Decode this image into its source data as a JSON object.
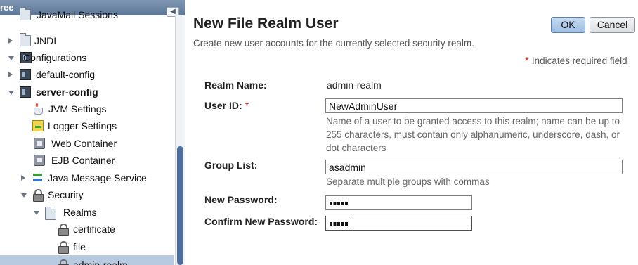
{
  "tree": {
    "header_title": "ree",
    "collapse_icon": "chevron-left-icon",
    "items": [
      {
        "label": "JavaMail Sessions",
        "icon": "folder-icon",
        "toggle": "none",
        "bold": false
      },
      {
        "label": "JNDI",
        "icon": "folder-icon",
        "toggle": "closed",
        "bold": false
      },
      {
        "label": "Configurations",
        "icon": "server-icon",
        "toggle": "open",
        "bold": false
      },
      {
        "label": "default-config",
        "icon": "server-icon",
        "toggle": "closed",
        "bold": false
      },
      {
        "label": "server-config",
        "icon": "server-icon",
        "toggle": "open",
        "bold": true
      },
      {
        "label": "JVM Settings",
        "icon": "jvm-icon",
        "toggle": "none",
        "bold": false
      },
      {
        "label": "Logger Settings",
        "icon": "logger-icon",
        "toggle": "none",
        "bold": false
      },
      {
        "label": "Web Container",
        "icon": "container-icon",
        "toggle": "none",
        "bold": false
      },
      {
        "label": "EJB Container",
        "icon": "container-icon",
        "toggle": "none",
        "bold": false
      },
      {
        "label": "Java Message Service",
        "icon": "jms-icon",
        "toggle": "closed",
        "bold": false
      },
      {
        "label": "Security",
        "icon": "lock-icon",
        "toggle": "open",
        "bold": false
      },
      {
        "label": "Realms",
        "icon": "folder-icon",
        "toggle": "open",
        "bold": false
      },
      {
        "label": "certificate",
        "icon": "lock-icon",
        "toggle": "none",
        "bold": false
      },
      {
        "label": "file",
        "icon": "lock-icon",
        "toggle": "none",
        "bold": false
      },
      {
        "label": "admin-realm",
        "icon": "lock-icon",
        "toggle": "none",
        "bold": false,
        "selected": true
      }
    ]
  },
  "page": {
    "title": "New File Realm User",
    "description": "Create new user accounts for the currently selected security realm.",
    "ok_label": "OK",
    "cancel_label": "Cancel",
    "required_marker": "*",
    "required_note": "Indicates required field"
  },
  "form": {
    "realm_name_label": "Realm Name:",
    "realm_name_value": "admin-realm",
    "user_id_label": "User ID:",
    "user_id_value": "NewAdminUser",
    "user_id_help": "Name of a user to be granted access to this realm; name can be up to 255 characters, must contain only alphanumeric, underscore, dash, or dot characters",
    "group_list_label": "Group List:",
    "group_list_value": "asadmin",
    "group_list_help": "Separate multiple groups with commas",
    "new_password_label": "New Password:",
    "new_password_value": "•••••",
    "confirm_password_label": "Confirm New Password:",
    "confirm_password_value": "•••••"
  },
  "colors": {
    "tree_header": "#6a83a3",
    "selected_row": "#b8cadf",
    "required_star": "#d9261c",
    "ok_button": "#b4cce9"
  }
}
